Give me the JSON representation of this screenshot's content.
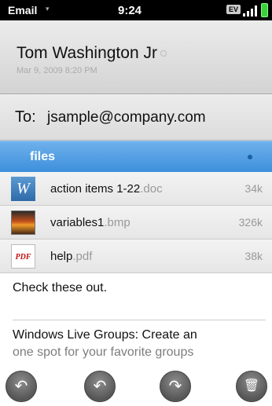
{
  "status_bar": {
    "app_name": "Email",
    "app_menu_icon": "▾",
    "time": "9:24",
    "network_badge": "EV",
    "icons": [
      "signal-icon",
      "battery-icon"
    ],
    "battery_color": "#3bd13b"
  },
  "message": {
    "sender": "Tom Washington Jr",
    "date": "Mar 9, 2009 8:20 PM",
    "to_label": "To:",
    "to_address": "jsample@company.com"
  },
  "attachments": {
    "header": "files",
    "accent_color": "#4a97e0",
    "items": [
      {
        "name": "action items 1-22",
        "ext": ".doc",
        "size": "34k",
        "icon": "word-doc-icon",
        "icon_glyph": "W"
      },
      {
        "name": "variables1",
        "ext": ".bmp",
        "size": "326k",
        "icon": "image-thumbnail-icon",
        "icon_glyph": ""
      },
      {
        "name": "help",
        "ext": ".pdf",
        "size": "38k",
        "icon": "pdf-icon",
        "icon_glyph": "PDF"
      }
    ]
  },
  "body": {
    "line1": "Check these out.",
    "line2": "Windows Live Groups: Create an",
    "line3": "one spot for your favorite groups"
  },
  "command_bar": {
    "buttons": [
      {
        "name": "reply-button",
        "icon": "reply-icon",
        "glyph": "↶"
      },
      {
        "name": "reply-all-button",
        "icon": "reply-all-icon",
        "glyph": "↶"
      },
      {
        "name": "forward-button",
        "icon": "forward-icon",
        "glyph": "↷"
      },
      {
        "name": "delete-button",
        "icon": "trash-icon",
        "glyph": "🗑"
      }
    ]
  }
}
